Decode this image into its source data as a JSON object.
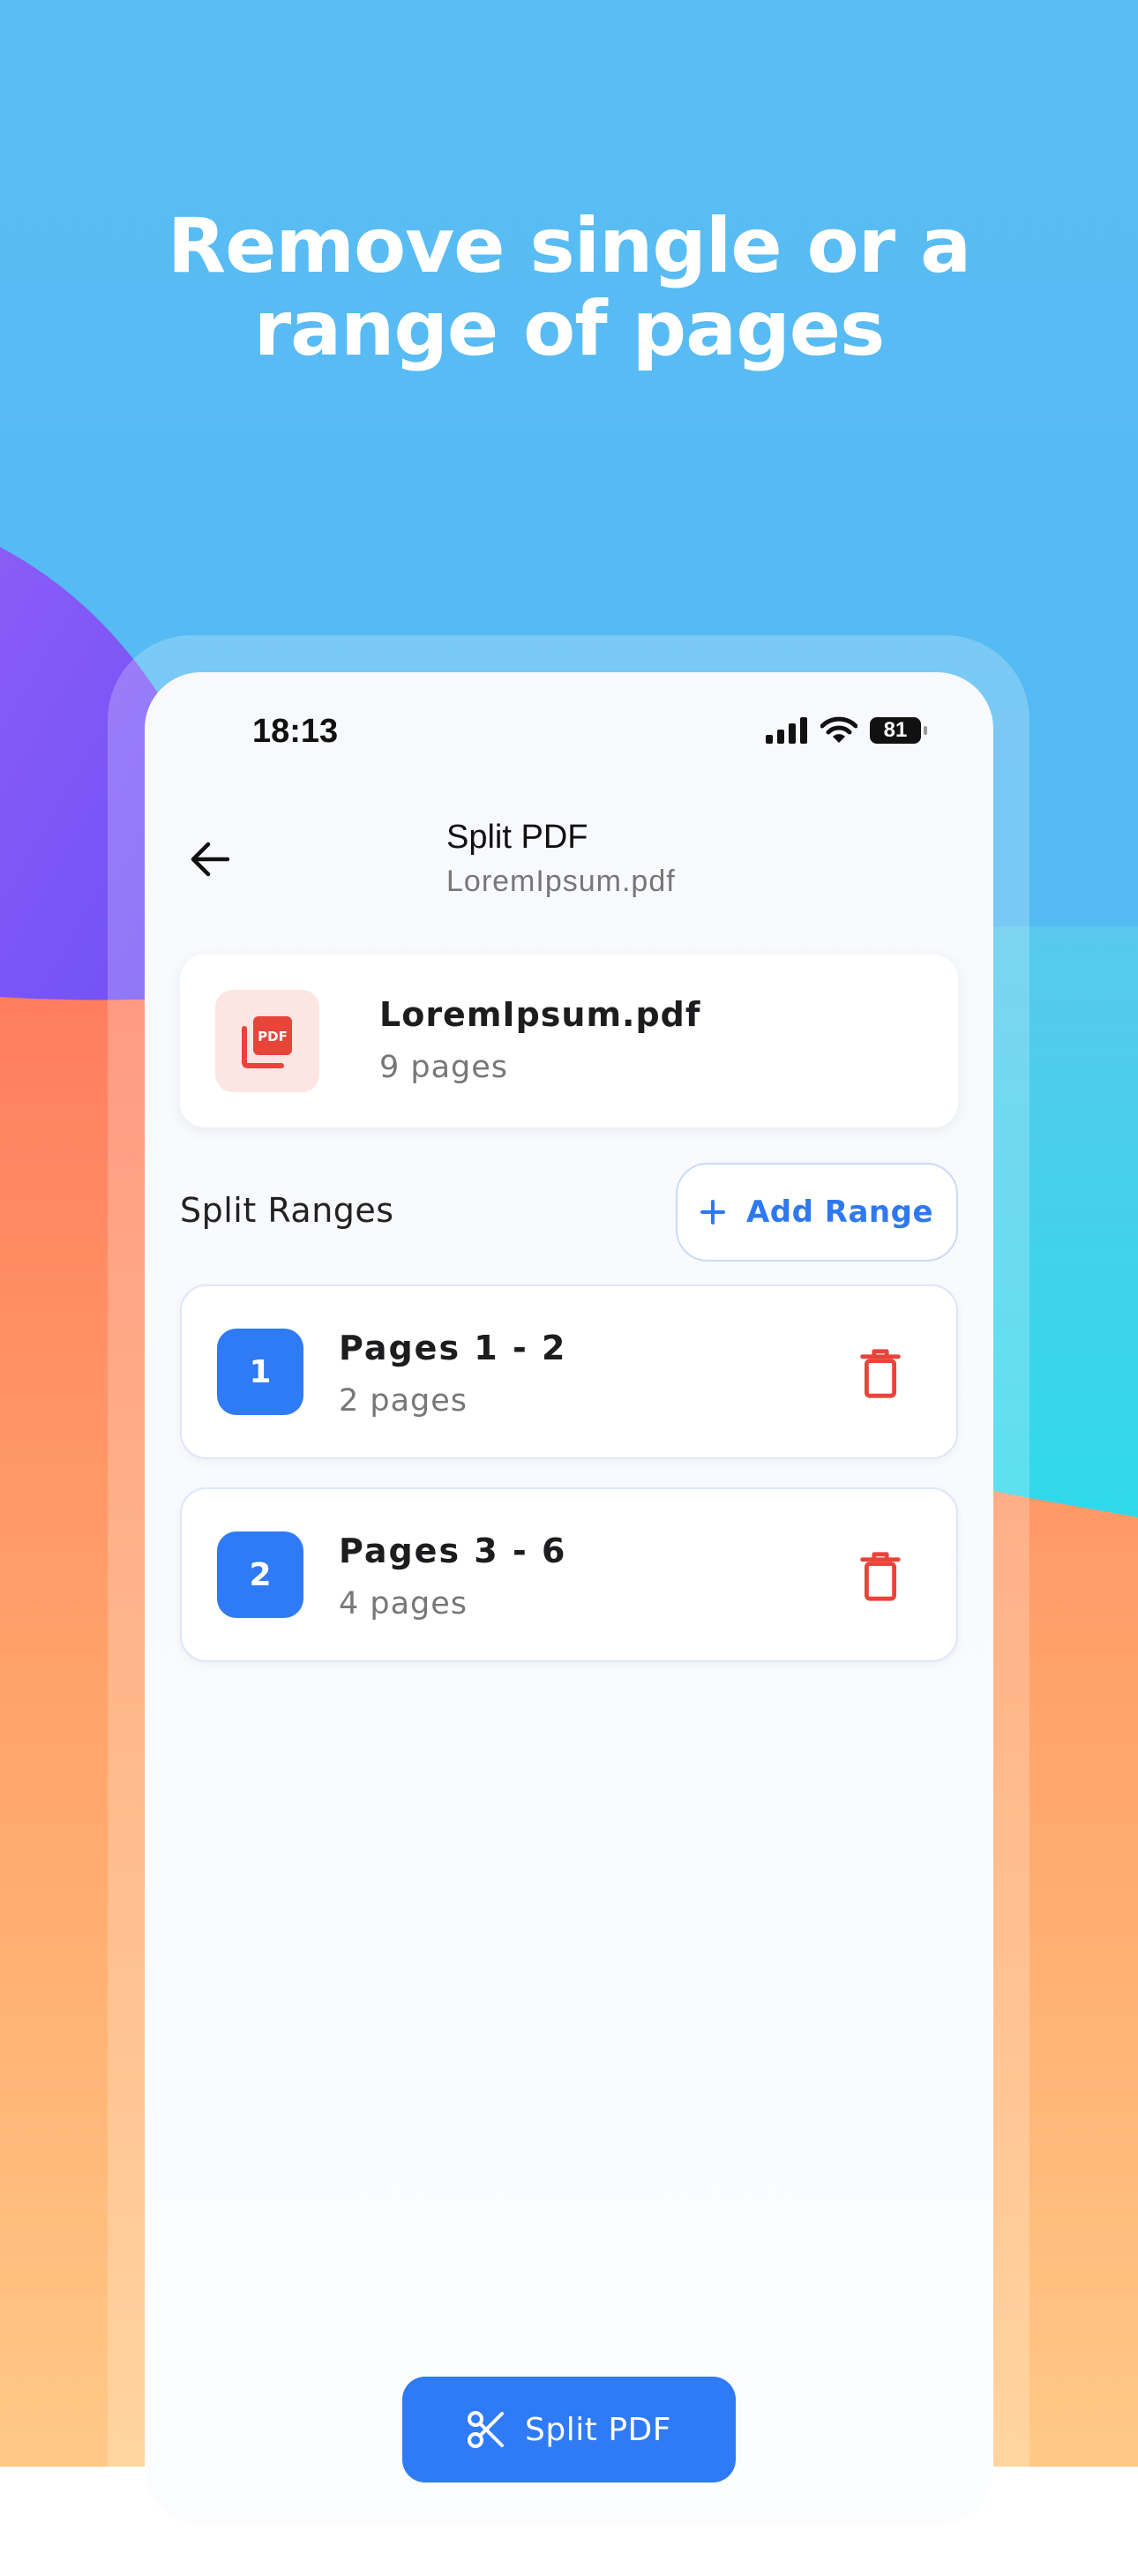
{
  "headline": {
    "line1": "Remove single or a",
    "line2": "range of pages"
  },
  "status_bar": {
    "time": "18:13",
    "battery": "81"
  },
  "nav": {
    "title": "Split PDF",
    "subtitle": "LoremIpsum.pdf"
  },
  "file": {
    "name": "LoremIpsum.pdf",
    "pages": "9 pages",
    "icon": "pdf-icon",
    "icon_label": "PDF"
  },
  "ranges": {
    "title": "Split Ranges",
    "add_label": "Add Range",
    "items": [
      {
        "index": "1",
        "title": "Pages 1 - 2",
        "count": "2 pages"
      },
      {
        "index": "2",
        "title": "Pages 3 - 6",
        "count": "4 pages"
      }
    ]
  },
  "action": {
    "label": "Split PDF",
    "icon": "scissors-icon"
  },
  "colors": {
    "accent": "#2f7af5",
    "danger": "#e8443a",
    "pdf_tile": "#fde5e3"
  }
}
